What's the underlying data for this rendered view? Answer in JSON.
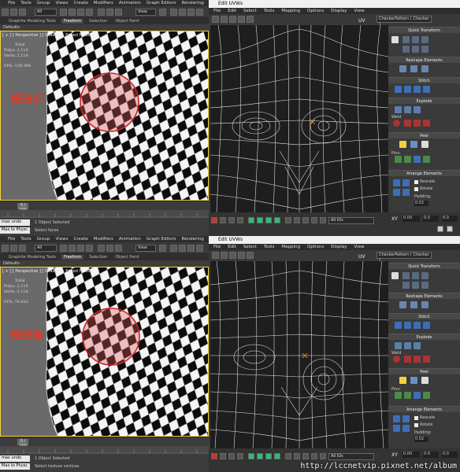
{
  "max": {
    "menu": [
      "File",
      "Tools",
      "Group",
      "Views",
      "Create",
      "Modifiers",
      "Animation",
      "Graph Editors",
      "Rendering"
    ],
    "selection_filter": "All",
    "view_dropdown": "View",
    "ribbon_tabs": [
      "Graphite Modeling Tools",
      "Freeform",
      "Selection",
      "Object Paint"
    ],
    "ribbon_active": "Freeform",
    "defaults_label": "Defaults",
    "viewport_label": "[ + ] [ Perspective ] [ Shaded + Edged Faces ]",
    "stats": {
      "header": "Total",
      "polys_label": "Polys:",
      "polys_value": "2,116",
      "verts_label": "Verts:",
      "verts_value": "2,118",
      "fps_label": "FPS:"
    },
    "frame_counter": "0 / 100",
    "prompt_undo": "max undo",
    "prompt_max": "Max to Physc",
    "status_selected": "1 Object Selected",
    "status_top_hint": "Select faces",
    "status_bottom_hint": "Select texture vertices"
  },
  "panels": [
    {
      "tag": "修改前",
      "fps": "159.394"
    },
    {
      "tag": "修改後",
      "fps": "76.632"
    }
  ],
  "uvw": {
    "window_title": "Edit UVWs",
    "menu": [
      "File",
      "Edit",
      "Select",
      "Tools",
      "Mapping",
      "Options",
      "Display",
      "View"
    ],
    "texture_dropdown": "CheckerPattern ( Checker )",
    "uv_label": "UV",
    "id_dropdown": "All IDs",
    "sections": [
      "Quick Transform",
      "Reshape Elements",
      "Stitch",
      "Explode",
      "Peel",
      "Arrange Elements"
    ],
    "weld_label": "Weld",
    "pins_label": "Pins:",
    "rescale_label": "Rescale",
    "rotate_label": "Rotate",
    "padding_label": "Padding:",
    "padding_value": "0.02",
    "xy_label": "XY",
    "u_value": "0.00",
    "v_value": "0.0",
    "w_value": "0.0"
  },
  "watermark": "http://lccnetvip.pixnet.net/album",
  "colors": {
    "annotation_red": "#e23a2a",
    "viewport_border": "#f5d33a",
    "uv_mesh": "#e8e8e8"
  }
}
